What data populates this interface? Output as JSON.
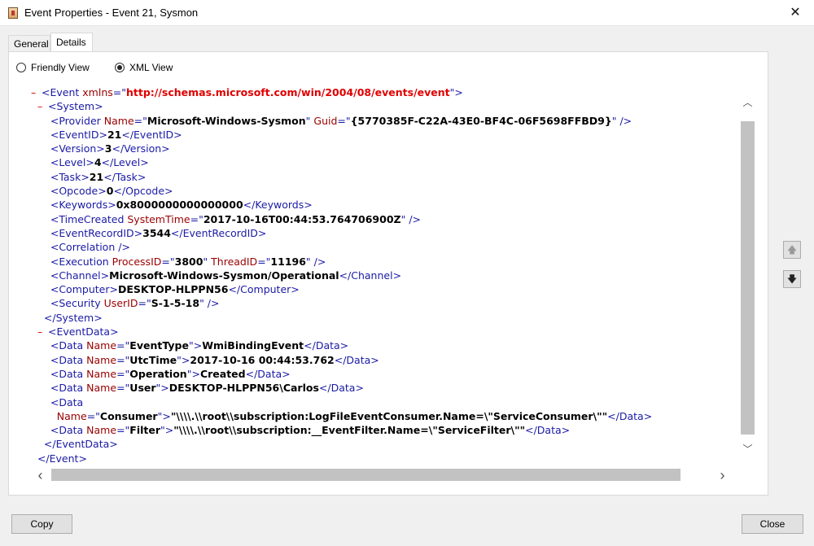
{
  "window": {
    "title": "Event Properties - Event 21, Sysmon",
    "close_glyph": "✕"
  },
  "tabs": [
    {
      "label": "General"
    },
    {
      "label": "Details"
    }
  ],
  "view_options": {
    "friendly": "Friendly View",
    "xml": "XML View",
    "selected": "XML View"
  },
  "xml": {
    "event_open_tag": "Event",
    "event_xmlns_attr": "xmlns",
    "event_xmlns_value": "http://schemas.microsoft.com/win/2004/08/events/event",
    "system_tag": "System",
    "provider": {
      "tag": "Provider",
      "name_attr": "Name",
      "name_value": "Microsoft-Windows-Sysmon",
      "guid_attr": "Guid",
      "guid_value": "{5770385F-C22A-43E0-BF4C-06F5698FFBD9}"
    },
    "event_id": {
      "tag": "EventID",
      "value": "21"
    },
    "version": {
      "tag": "Version",
      "value": "3"
    },
    "level": {
      "tag": "Level",
      "value": "4"
    },
    "task": {
      "tag": "Task",
      "value": "21"
    },
    "opcode": {
      "tag": "Opcode",
      "value": "0"
    },
    "keywords": {
      "tag": "Keywords",
      "value": "0x8000000000000000"
    },
    "time_created": {
      "tag": "TimeCreated",
      "attr": "SystemTime",
      "value": "2017-10-16T00:44:53.764706900Z"
    },
    "event_record_id": {
      "tag": "EventRecordID",
      "value": "3544"
    },
    "correlation": {
      "tag": "Correlation"
    },
    "execution": {
      "tag": "Execution",
      "pid_attr": "ProcessID",
      "pid_value": "3800",
      "tid_attr": "ThreadID",
      "tid_value": "11196"
    },
    "channel": {
      "tag": "Channel",
      "value": "Microsoft-Windows-Sysmon/Operational"
    },
    "computer": {
      "tag": "Computer",
      "value": "DESKTOP-HLPPN56"
    },
    "security": {
      "tag": "Security",
      "attr": "UserID",
      "value": "S-1-5-18"
    },
    "event_data_tag": "EventData",
    "data_tag": "Data",
    "name_attr": "Name",
    "data": [
      {
        "name": "EventType",
        "value": "WmiBindingEvent"
      },
      {
        "name": "UtcTime",
        "value": "2017-10-16 00:44:53.762"
      },
      {
        "name": "Operation",
        "value": "Created"
      },
      {
        "name": "User",
        "value": "DESKTOP-HLPPN56\\Carlos"
      },
      {
        "name": "Consumer",
        "value": "\"\\\\\\\\.\\\\root\\\\subscription:LogFileEventConsumer.Name=\\\"ServiceConsumer\\\"\""
      },
      {
        "name": "Filter",
        "value": "\"\\\\\\\\.\\\\root\\\\subscription:__EventFilter.Name=\\\"ServiceFilter\\\"\""
      }
    ]
  },
  "scroll": {
    "up": "︿",
    "down": "﹀",
    "left": "‹",
    "right": "›"
  },
  "nav": {
    "prev_glyph": "🡅",
    "next_glyph": "🡇"
  },
  "buttons": {
    "copy": "Copy",
    "close": "Close"
  }
}
